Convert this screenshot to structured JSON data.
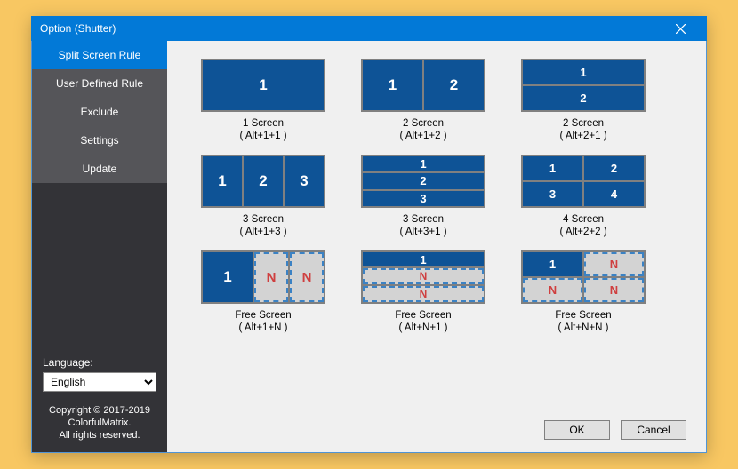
{
  "window": {
    "title": "Option (Shutter)"
  },
  "sidebar": {
    "items": [
      {
        "label": "Split Screen Rule",
        "active": true
      },
      {
        "label": "User Defined Rule",
        "active": false
      },
      {
        "label": "Exclude",
        "active": false
      },
      {
        "label": "Settings",
        "active": false
      },
      {
        "label": "Update",
        "active": false
      }
    ],
    "language_label": "Language:",
    "language_value": "English",
    "copyright_line1": "Copyright © 2017-2019",
    "copyright_line2": "ColorfulMatrix.",
    "copyright_line3": "All rights reserved."
  },
  "rules": [
    {
      "title": "1 Screen",
      "shortcut": "( Alt+1+1 )"
    },
    {
      "title": "2 Screen",
      "shortcut": "( Alt+1+2 )"
    },
    {
      "title": "2 Screen",
      "shortcut": "( Alt+2+1 )"
    },
    {
      "title": "3 Screen",
      "shortcut": "( Alt+1+3 )"
    },
    {
      "title": "3 Screen",
      "shortcut": "( Alt+3+1 )"
    },
    {
      "title": "4 Screen",
      "shortcut": "( Alt+2+2 )"
    },
    {
      "title": "Free Screen",
      "shortcut": "( Alt+1+N )"
    },
    {
      "title": "Free Screen",
      "shortcut": "( Alt+N+1 )"
    },
    {
      "title": "Free Screen",
      "shortcut": "( Alt+N+N )"
    }
  ],
  "tiles": {
    "n1": "1",
    "n2": "2",
    "n3": "3",
    "n4": "4",
    "N": "N"
  },
  "buttons": {
    "ok": "OK",
    "cancel": "Cancel"
  }
}
